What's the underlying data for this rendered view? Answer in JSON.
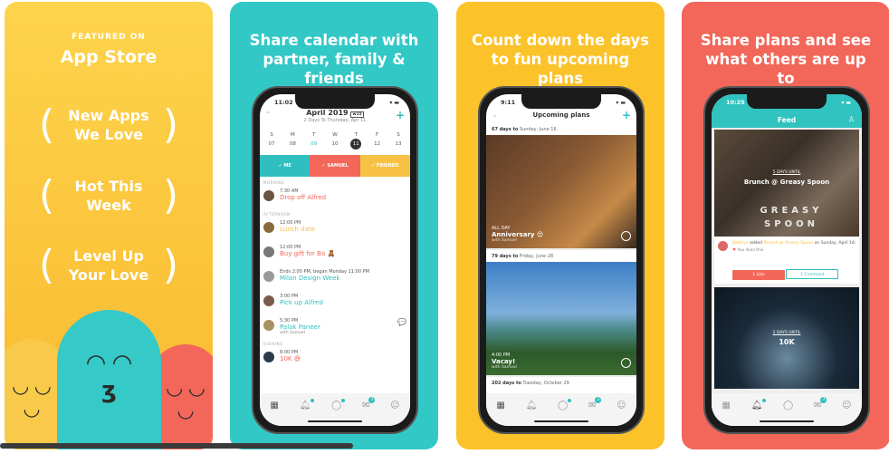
{
  "panel1": {
    "featured": "FEATURED ON",
    "store": "App Store",
    "awards": [
      "New Apps We Love",
      "Hot This Week",
      "Level Up Your Love"
    ],
    "icons": [
      "apple-logo-icon",
      "laurel-icon"
    ],
    "colors": {
      "bg": "#fcc93b",
      "left": "#f9c94a",
      "mid": "#35c9c7",
      "right": "#f2675a"
    }
  },
  "panel2": {
    "headline": "Share calendar with partner, family & friends",
    "time": "11:02",
    "month": "April 2019",
    "week_badge": "w15",
    "subtitle": "2 Days To Thursday, Apr 11",
    "days": [
      {
        "l": "S",
        "d": "07"
      },
      {
        "l": "M",
        "d": "08"
      },
      {
        "l": "T",
        "d": "09"
      },
      {
        "l": "W",
        "d": "10"
      },
      {
        "l": "T",
        "d": "11"
      },
      {
        "l": "F",
        "d": "12"
      },
      {
        "l": "S",
        "d": "13"
      }
    ],
    "filters": [
      "✓ ME",
      "✓ SAMUEL",
      "✓ FRIENDS"
    ],
    "sections": {
      "morning": "MORNING",
      "afternoon": "AFTERNOON",
      "evening": "EVENING"
    },
    "items": [
      {
        "time": "7:30 AM",
        "name": "Drop off Alfred",
        "color": "#f2675a"
      },
      {
        "time": "12:00 PM",
        "name": "Lunch date",
        "color": "#f7c244"
      },
      {
        "time": "12:00 PM",
        "name": "Buy gift for Bo 🧸",
        "color": "#f2675a"
      },
      {
        "time": "Ends 2:00 PM, began Monday 11:00 PM",
        "name": "Milan Design Week",
        "color": "#2fbfc1"
      },
      {
        "time": "3:00 PM",
        "name": "Pick up Alfred",
        "color": "#2fbfc1"
      },
      {
        "time": "5:30 PM",
        "name": "Palak Paneer",
        "with": "with Samuel",
        "color": "#2fbfc1"
      },
      {
        "time": "8:00 PM",
        "name": "10K 😅",
        "color": "#f2675a"
      }
    ]
  },
  "panel3": {
    "headline": "Count down the days to fun upcoming plans",
    "time": "9:11",
    "title": "Upcoming plans",
    "plans": [
      {
        "days": "67 days to",
        "date": "Sunday, June 16",
        "when": "ALL DAY",
        "name": "Anniversary 😍",
        "with": "with Samuel"
      },
      {
        "days": "79 days to",
        "date": "Friday, June 28",
        "when": "4:00 PM",
        "name": "Vacay!",
        "with": "with Samuel"
      },
      {
        "days": "202 days to",
        "date": "Tuesday, October 29"
      }
    ]
  },
  "panel4": {
    "headline": "Share plans and see what others are up to",
    "time": "10:25",
    "title": "Feed",
    "card1": {
      "until": "5 DAYS UNTIL",
      "name": "Brunch @ Greasy Spoon",
      "logo": "GREASY SPOON"
    },
    "activity": {
      "user": "Kathryn",
      "verb": "added",
      "plan": "Brunch @ Greasy Spoon",
      "on": "on Sunday, April 14",
      "ago": "5m",
      "likes": "You likes this",
      "like_btn": "1 Like",
      "comment_btn": "1 Comment"
    },
    "card2": {
      "until": "2 DAYS UNTIL",
      "name": "10K"
    }
  },
  "tab_badge": "3"
}
